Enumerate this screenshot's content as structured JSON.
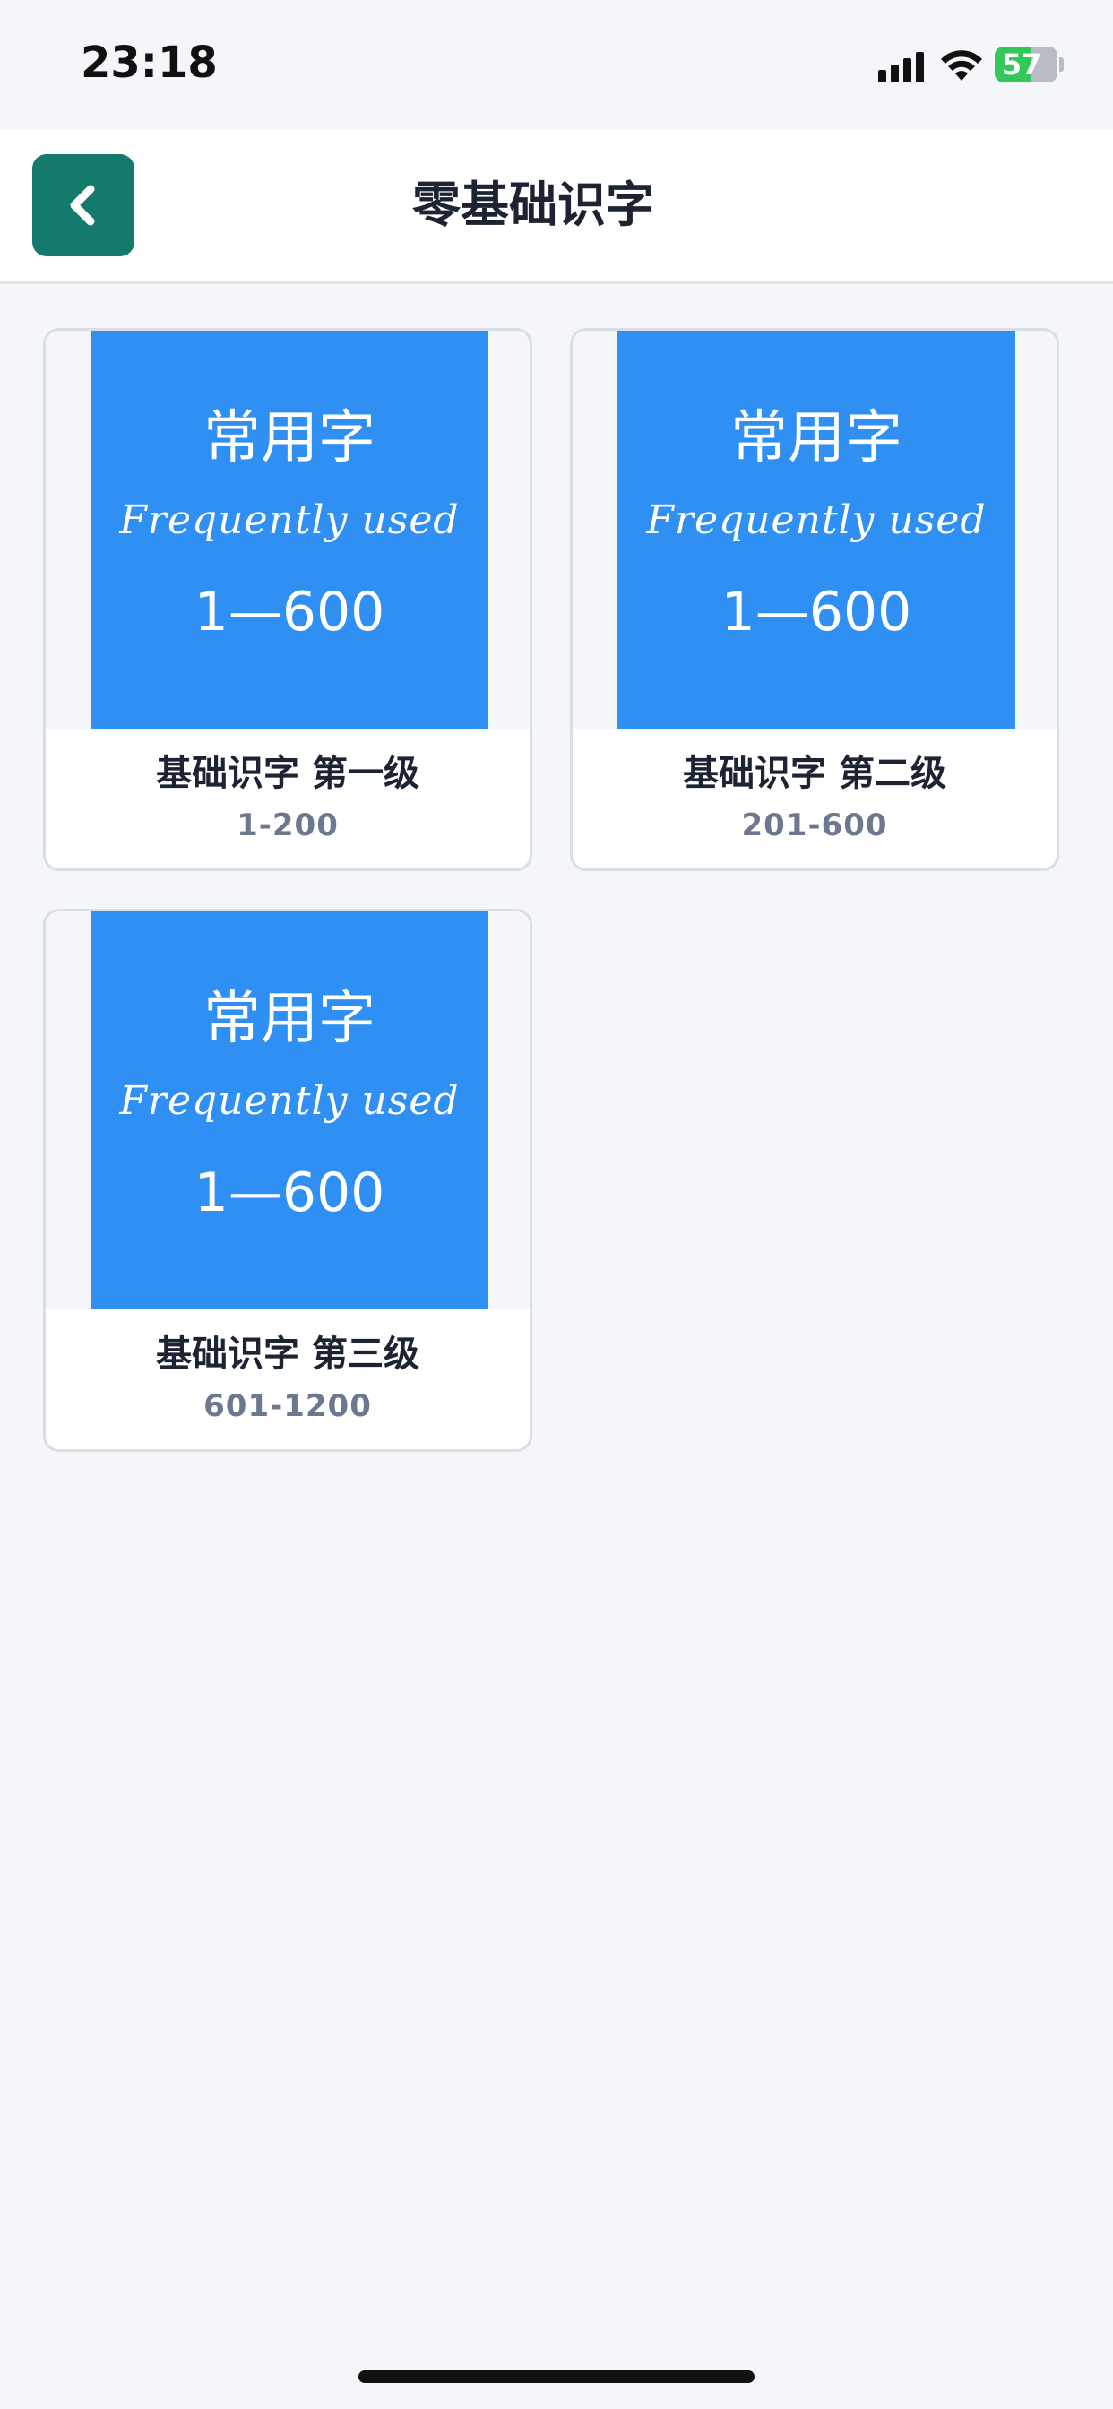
{
  "status_bar": {
    "time": "23:18",
    "battery_percent": 57,
    "battery_label": "57",
    "signal_icon": "signal-bars-icon",
    "wifi_icon": "wifi-icon",
    "charging": true
  },
  "nav": {
    "title": "零基础识字",
    "back_icon": "chevron-left-icon",
    "back_button_color": "#147a6c"
  },
  "cards": [
    {
      "cover": {
        "title": "常用字",
        "subtitle": "Frequently used",
        "range": "1—600"
      },
      "title": "基础识字 第一级",
      "range": "1-200"
    },
    {
      "cover": {
        "title": "常用字",
        "subtitle": "Frequently used",
        "range": "1—600"
      },
      "title": "基础识字 第二级",
      "range": "201-600"
    },
    {
      "cover": {
        "title": "常用字",
        "subtitle": "Frequently used",
        "range": "1—600"
      },
      "title": "基础识字 第三级",
      "range": "601-1200"
    }
  ],
  "colors": {
    "cover_blue": "#2f8ff2",
    "background": "#f5f6fa",
    "title_text": "#1c2333",
    "range_text": "#6b7890"
  }
}
